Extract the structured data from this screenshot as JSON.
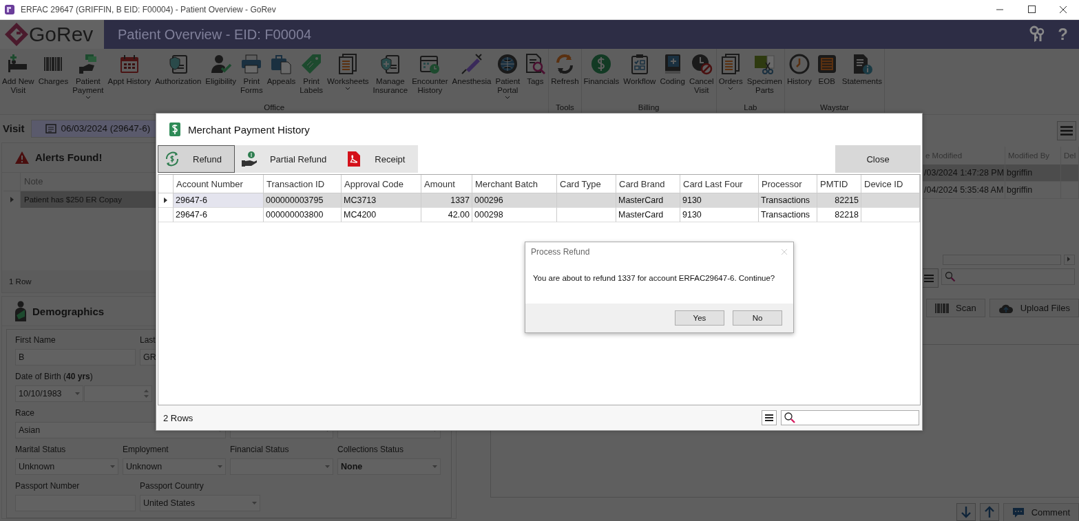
{
  "window": {
    "title": "ERFAC 29647 (GRIFFIN, B EID: F00004) - Patient Overview - GoRev"
  },
  "header": {
    "app_name": "GoRev",
    "page_title": "Patient Overview - EID: F00004",
    "help": "?"
  },
  "ribbon": {
    "groups": [
      {
        "label": "Office",
        "items": [
          {
            "label": "Add New\nVisit",
            "menu": false
          },
          {
            "label": "Charges",
            "menu": false
          },
          {
            "label": "Patient\nPayment",
            "menu": true
          },
          {
            "label": "Appt History",
            "menu": false
          },
          {
            "label": "Authorization",
            "menu": false
          },
          {
            "label": "Eligibility",
            "menu": false
          },
          {
            "label": "Print\nForms",
            "menu": false
          },
          {
            "label": "Appeals",
            "menu": false
          },
          {
            "label": "Print\nLabels",
            "menu": false
          },
          {
            "label": "Worksheets",
            "menu": true
          },
          {
            "label": "Manage\nInsurance",
            "menu": false
          },
          {
            "label": "Encounter\nHistory",
            "menu": false
          },
          {
            "label": "Anesthesia",
            "menu": false
          },
          {
            "label": "Patient\nPortal",
            "menu": true
          },
          {
            "label": "Tags",
            "menu": false
          }
        ]
      },
      {
        "label": "Tools",
        "items": [
          {
            "label": "Refresh",
            "menu": false
          }
        ]
      },
      {
        "label": "Billing",
        "items": [
          {
            "label": "Financials",
            "menu": false
          },
          {
            "label": "Workflow",
            "menu": false
          },
          {
            "label": "Coding",
            "menu": false
          },
          {
            "label": "Cancel\nVisit",
            "menu": false
          }
        ]
      },
      {
        "label": "Lab",
        "items": [
          {
            "label": "Orders",
            "menu": true
          },
          {
            "label": "Specimen\nParts",
            "menu": false
          }
        ]
      },
      {
        "label": "Waystar",
        "items": [
          {
            "label": "History",
            "menu": false
          },
          {
            "label": "EOB",
            "menu": false
          },
          {
            "label": "Statements",
            "menu": false
          }
        ]
      }
    ]
  },
  "visit": {
    "label": "Visit",
    "value": "06/03/2024 (29647-6)"
  },
  "alerts": {
    "title": "Alerts Found!",
    "columns": [
      "Note"
    ],
    "rows": [
      {
        "note": "Patient has $250 ER Copay",
        "selected": true
      }
    ],
    "footer": "1 Row"
  },
  "demographics": {
    "title": "Demographics",
    "rows": [
      [
        {
          "label": "First Name",
          "value": "B",
          "kind": "text"
        },
        {
          "label": "Last",
          "value": "GR",
          "kind": "text"
        }
      ],
      [
        {
          "label": "Date of Birth (**40 yrs**)",
          "value": "10/10/1983",
          "kind": "select"
        },
        {
          "kind": "spin"
        }
      ],
      [
        {
          "label": "Race",
          "value": "Asian",
          "kind": "select"
        },
        {
          "kind": "select"
        },
        {
          "kind": "select"
        }
      ],
      [
        {
          "label": "Marital Status",
          "value": "Unknown",
          "kind": "select"
        },
        {
          "label": "Employment",
          "value": "Unknown",
          "kind": "select"
        },
        {
          "label": "Financial Status",
          "kind": "select"
        },
        {
          "label": "Collections Status",
          "value": "None",
          "kind": "select",
          "bold": true
        }
      ],
      [
        {
          "label": "Passport Number",
          "kind": "text"
        },
        {
          "label": "Passport Country",
          "value": "United States",
          "kind": "select"
        }
      ]
    ]
  },
  "documents": {
    "columns": [
      "e Modified",
      "Modified By",
      "Del"
    ],
    "rows": [
      {
        "selected": true,
        "cells": [
          "/03/2024 1:47:28 PM",
          "bgriffin",
          null
        ]
      },
      {
        "selected": false,
        "cells": [
          "/04/2024 5:35:48 AM",
          "bgriffin",
          null
        ]
      }
    ],
    "buttons": [
      "Scan",
      "Upload Files"
    ],
    "comment_button": "Comment"
  },
  "payment_history": {
    "title": "Merchant Payment History",
    "actions": [
      {
        "label": "Refund",
        "selected": true
      },
      {
        "label": "Partial Refund",
        "selected": false
      },
      {
        "label": "Receipt",
        "selected": false
      }
    ],
    "close": "Close",
    "columns": [
      {
        "label": "Account Number"
      },
      {
        "label": "Transaction ID"
      },
      {
        "label": "Approval Code"
      },
      {
        "label": "Amount",
        "numeric": true
      },
      {
        "label": "Merchant Batch"
      },
      {
        "label": "Card Type"
      },
      {
        "label": "Card Brand"
      },
      {
        "label": "Card Last Four"
      },
      {
        "label": "Processor"
      },
      {
        "label": "PMTID",
        "numeric": true
      },
      {
        "label": "Device ID"
      }
    ],
    "rows": [
      {
        "selected": true,
        "cells": [
          "29647-6",
          "000000003795",
          "MC3713",
          "1337",
          "000296",
          null,
          "MasterCard",
          "9130",
          "Transactions",
          "82215",
          null
        ]
      },
      {
        "selected": false,
        "cells": [
          "29647-6",
          "000000003800",
          "MC4200",
          "42.00",
          "000298",
          null,
          "MasterCard",
          "9130",
          "Transactions",
          "82218",
          null
        ]
      }
    ],
    "footer": "2 Rows"
  },
  "confirm": {
    "title": "Process Refund",
    "message": "You are about to refund 1337 for account ERFAC29647-6. Continue?",
    "buttons": [
      "Yes",
      "No"
    ]
  }
}
